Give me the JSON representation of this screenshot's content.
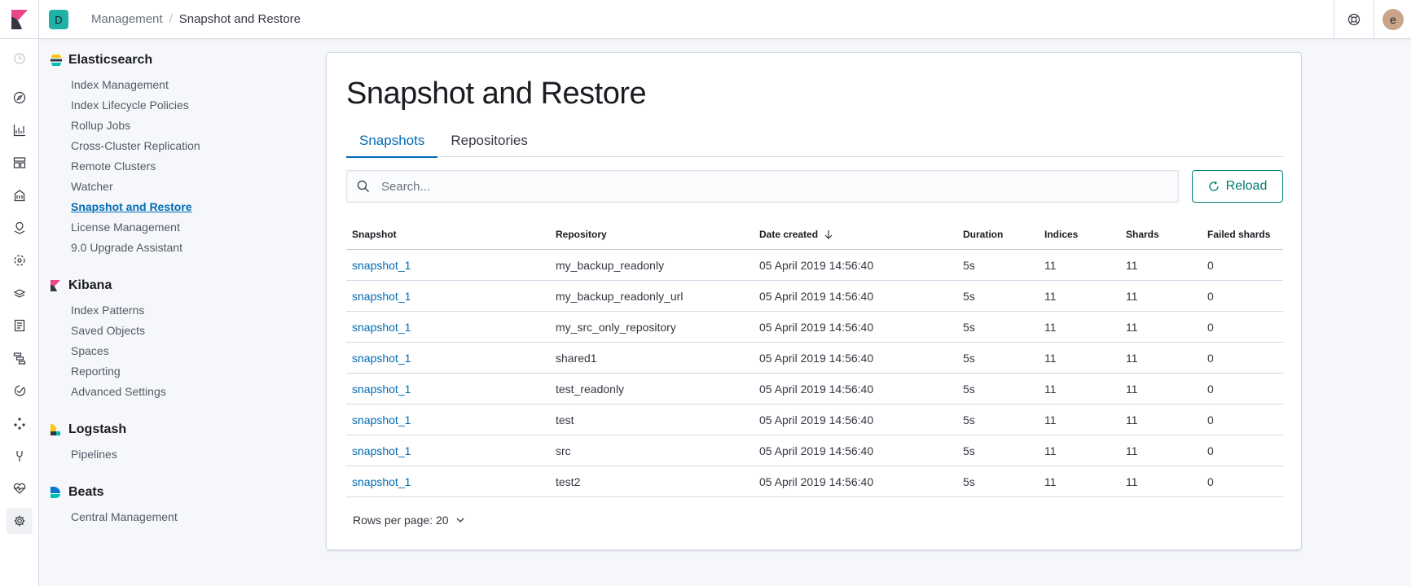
{
  "header": {
    "space_initial": "D",
    "breadcrumbs": [
      "Management",
      "Snapshot and Restore"
    ],
    "user_initial": "e"
  },
  "nav_icons": [
    "clock-icon",
    "compass-icon",
    "visualize-icon",
    "dashboard-icon",
    "canvas-icon",
    "maps-icon",
    "ml-icon",
    "infrastructure-icon",
    "logs-icon",
    "apm-icon",
    "uptime-icon",
    "graph-icon",
    "devtools-icon",
    "monitoring-icon",
    "management-gear-icon"
  ],
  "sidebar": {
    "sections": [
      {
        "title": "Elasticsearch",
        "items": [
          "Index Management",
          "Index Lifecycle Policies",
          "Rollup Jobs",
          "Cross-Cluster Replication",
          "Remote Clusters",
          "Watcher",
          "Snapshot and Restore",
          "License Management",
          "9.0 Upgrade Assistant"
        ],
        "active_index": 6
      },
      {
        "title": "Kibana",
        "items": [
          "Index Patterns",
          "Saved Objects",
          "Spaces",
          "Reporting",
          "Advanced Settings"
        ]
      },
      {
        "title": "Logstash",
        "items": [
          "Pipelines"
        ]
      },
      {
        "title": "Beats",
        "items": [
          "Central Management"
        ]
      }
    ]
  },
  "page": {
    "title": "Snapshot and Restore",
    "tabs": [
      "Snapshots",
      "Repositories"
    ],
    "search_placeholder": "Search...",
    "reload_label": "Reload"
  },
  "table": {
    "columns": [
      "Snapshot",
      "Repository",
      "Date created",
      "Duration",
      "Indices",
      "Shards",
      "Failed shards"
    ],
    "rows": [
      [
        "snapshot_1",
        "my_backup_readonly",
        "05 April 2019 14:56:40",
        "5s",
        "11",
        "11",
        "0"
      ],
      [
        "snapshot_1",
        "my_backup_readonly_url",
        "05 April 2019 14:56:40",
        "5s",
        "11",
        "11",
        "0"
      ],
      [
        "snapshot_1",
        "my_src_only_repository",
        "05 April 2019 14:56:40",
        "5s",
        "11",
        "11",
        "0"
      ],
      [
        "snapshot_1",
        "shared1",
        "05 April 2019 14:56:40",
        "5s",
        "11",
        "11",
        "0"
      ],
      [
        "snapshot_1",
        "test_readonly",
        "05 April 2019 14:56:40",
        "5s",
        "11",
        "11",
        "0"
      ],
      [
        "snapshot_1",
        "test",
        "05 April 2019 14:56:40",
        "5s",
        "11",
        "11",
        "0"
      ],
      [
        "snapshot_1",
        "src",
        "05 April 2019 14:56:40",
        "5s",
        "11",
        "11",
        "0"
      ],
      [
        "snapshot_1",
        "test2",
        "05 April 2019 14:56:40",
        "5s",
        "11",
        "11",
        "0"
      ]
    ],
    "rows_per_page": "Rows per page: 20"
  },
  "colors": {
    "link": "#006bb4",
    "reload": "#017d73",
    "space_avatar": "#20b2a8"
  }
}
